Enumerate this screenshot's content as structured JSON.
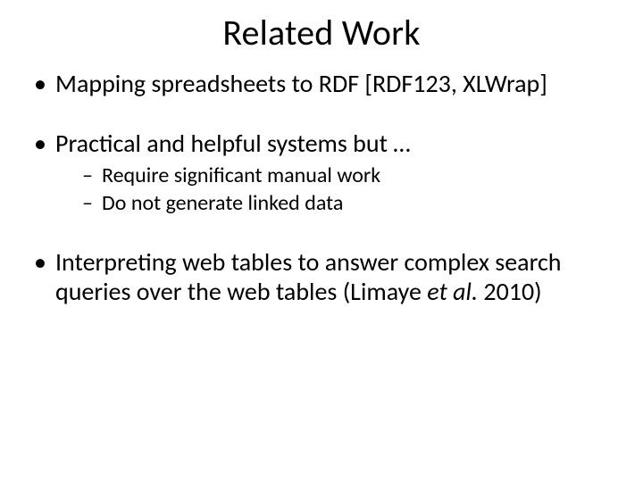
{
  "title": "Related Work",
  "bullets": {
    "b1": "Mapping spreadsheets to RDF [RDF123, XLWrap]",
    "b2": {
      "text": "Practical and helpful systems but …",
      "sub": [
        "Require significant manual work",
        "Do not generate linked data"
      ]
    },
    "b3": {
      "pre": "Interpreting web tables to answer complex search queries over the web tables ",
      "cite_open": "(Limaye ",
      "cite_ital": "et al.",
      "cite_close": " 2010)"
    }
  }
}
